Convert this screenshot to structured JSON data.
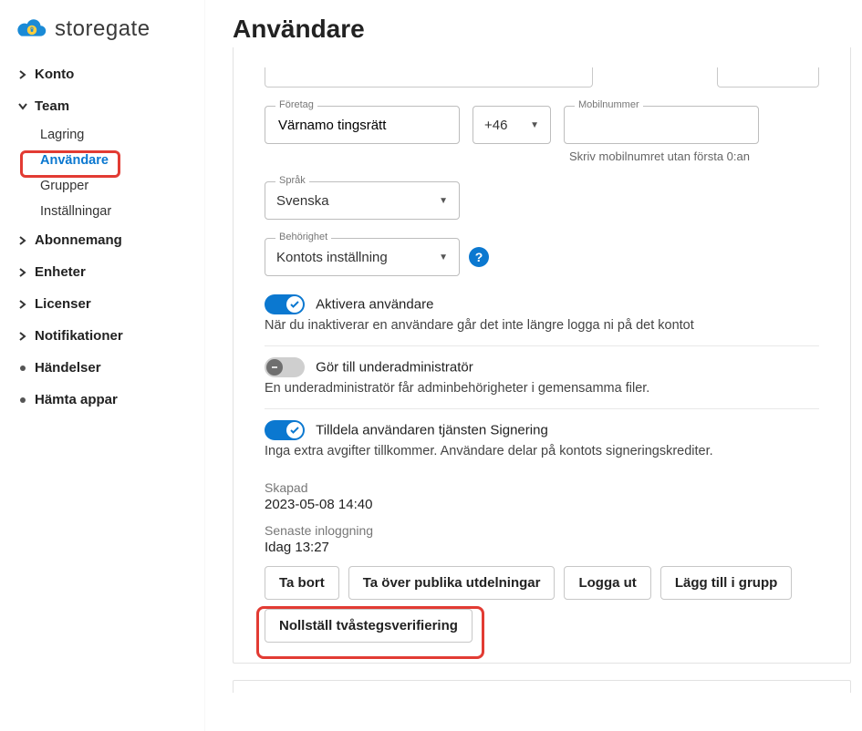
{
  "brand": {
    "name": "storegate"
  },
  "sidebar": {
    "konto": "Konto",
    "team": "Team",
    "team_items": {
      "lagring": "Lagring",
      "anvandare": "Användare",
      "grupper": "Grupper",
      "installningar": "Inställningar"
    },
    "abonnemang": "Abonnemang",
    "enheter": "Enheter",
    "licenser": "Licenser",
    "notifikationer": "Notifikationer",
    "handelser": "Händelser",
    "hamta_appar": "Hämta appar"
  },
  "page": {
    "title": "Användare"
  },
  "fields": {
    "foretag": {
      "label": "Företag",
      "value": "Värnamo tingsrätt"
    },
    "dial": {
      "value": "+46"
    },
    "mobil": {
      "label": "Mobilnummer",
      "hint": "Skriv mobilnumret utan första 0:an"
    },
    "sprak": {
      "label": "Språk",
      "value": "Svenska"
    },
    "behorighet": {
      "label": "Behörighet",
      "value": "Kontots inställning"
    }
  },
  "toggles": {
    "aktivera": {
      "label": "Aktivera användare",
      "desc": "När du inaktiverar en användare går det inte längre logga ni på det kontot"
    },
    "underadmin": {
      "label": "Gör till underadministratör",
      "desc": "En underadministratör får adminbehörigheter i gemensamma filer."
    },
    "signering": {
      "label": "Tilldela användaren tjänsten Signering",
      "desc": "Inga extra avgifter tillkommer. Användare delar på kontots signeringskrediter."
    }
  },
  "meta": {
    "skapad_label": "Skapad",
    "skapad_value": "2023-05-08 14:40",
    "senaste_label": "Senaste inloggning",
    "senaste_value": "Idag 13:27"
  },
  "buttons": {
    "tabort": "Ta bort",
    "taover": "Ta över publika utdelningar",
    "loggaut": "Logga ut",
    "grupp": "Lägg till i grupp",
    "nollstall": "Nollställ tvåstegsverifiering"
  }
}
